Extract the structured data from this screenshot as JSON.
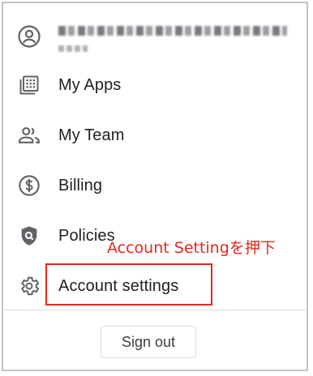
{
  "account": {
    "name": "— — —",
    "sub": "—"
  },
  "menu": {
    "items": [
      {
        "label": "My Apps",
        "icon": "apps-grid-icon"
      },
      {
        "label": "My Team",
        "icon": "team-icon"
      },
      {
        "label": "Billing",
        "icon": "dollar-circle-icon"
      },
      {
        "label": "Policies",
        "icon": "shield-icon"
      },
      {
        "label": "Account settings",
        "icon": "gear-icon"
      }
    ]
  },
  "annotation": {
    "text": "Account Settingを押下",
    "color": "#e8261c"
  },
  "signout": {
    "label": "Sign out"
  },
  "colors": {
    "text": "#202124",
    "icon": "#5f6368",
    "highlight": "#e0291f"
  }
}
